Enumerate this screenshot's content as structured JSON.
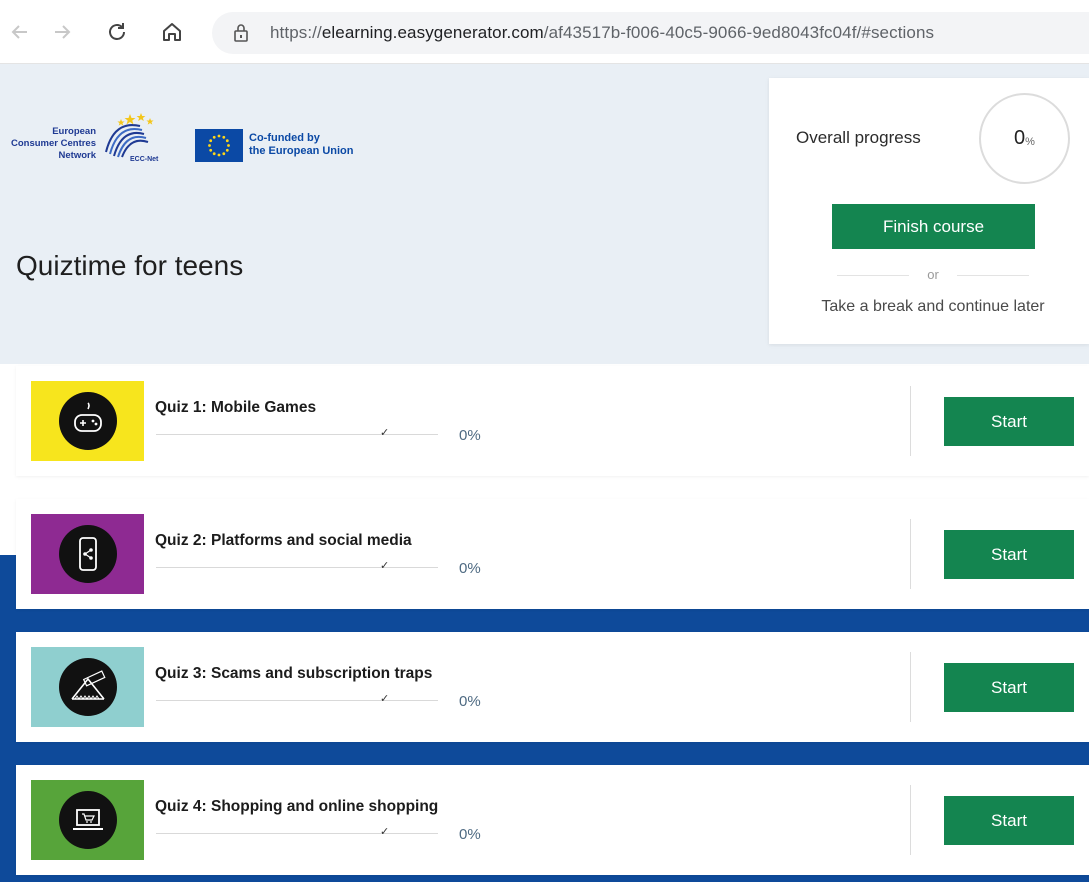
{
  "browser": {
    "url_prefix": "https://",
    "url_host": "elearning.easygenerator.com",
    "url_path": "/af43517b-f006-40c5-9066-9ed8043fc04f/#sections"
  },
  "logos": {
    "ecc_text_line1": "European",
    "ecc_text_line2": "Consumer Centres",
    "ecc_text_line3": "Network",
    "ecc_net": "ECC-Net",
    "eu_text_line1": "Co-funded by",
    "eu_text_line2": "the European Union"
  },
  "course": {
    "title": "Quiztime for teens"
  },
  "progress": {
    "label": "Overall progress",
    "value": "0",
    "unit": "%",
    "finish_label": "Finish course",
    "or_label": "or",
    "break_label": "Take a break and continue later"
  },
  "quizzes": [
    {
      "title": "Quiz 1: Mobile Games",
      "progress": "0%",
      "start_label": "Start",
      "thumb_color": "#f7e51d",
      "icon": "gamepad-icon"
    },
    {
      "title": "Quiz 2: Platforms and social media",
      "progress": "0%",
      "start_label": "Start",
      "thumb_color": "#8e2a92",
      "icon": "phone-share-icon"
    },
    {
      "title": "Quiz 3: Scams and subscription traps",
      "progress": "0%",
      "start_label": "Start",
      "thumb_color": "#8fcfcf",
      "icon": "trap-icon"
    },
    {
      "title": "Quiz 4: Shopping and online shopping",
      "progress": "0%",
      "start_label": "Start",
      "thumb_color": "#57a43a",
      "icon": "laptop-cart-icon"
    }
  ],
  "colors": {
    "accent_green": "#148550",
    "header_bg": "#e9eff5",
    "band_blue": "#0e4a9a"
  }
}
